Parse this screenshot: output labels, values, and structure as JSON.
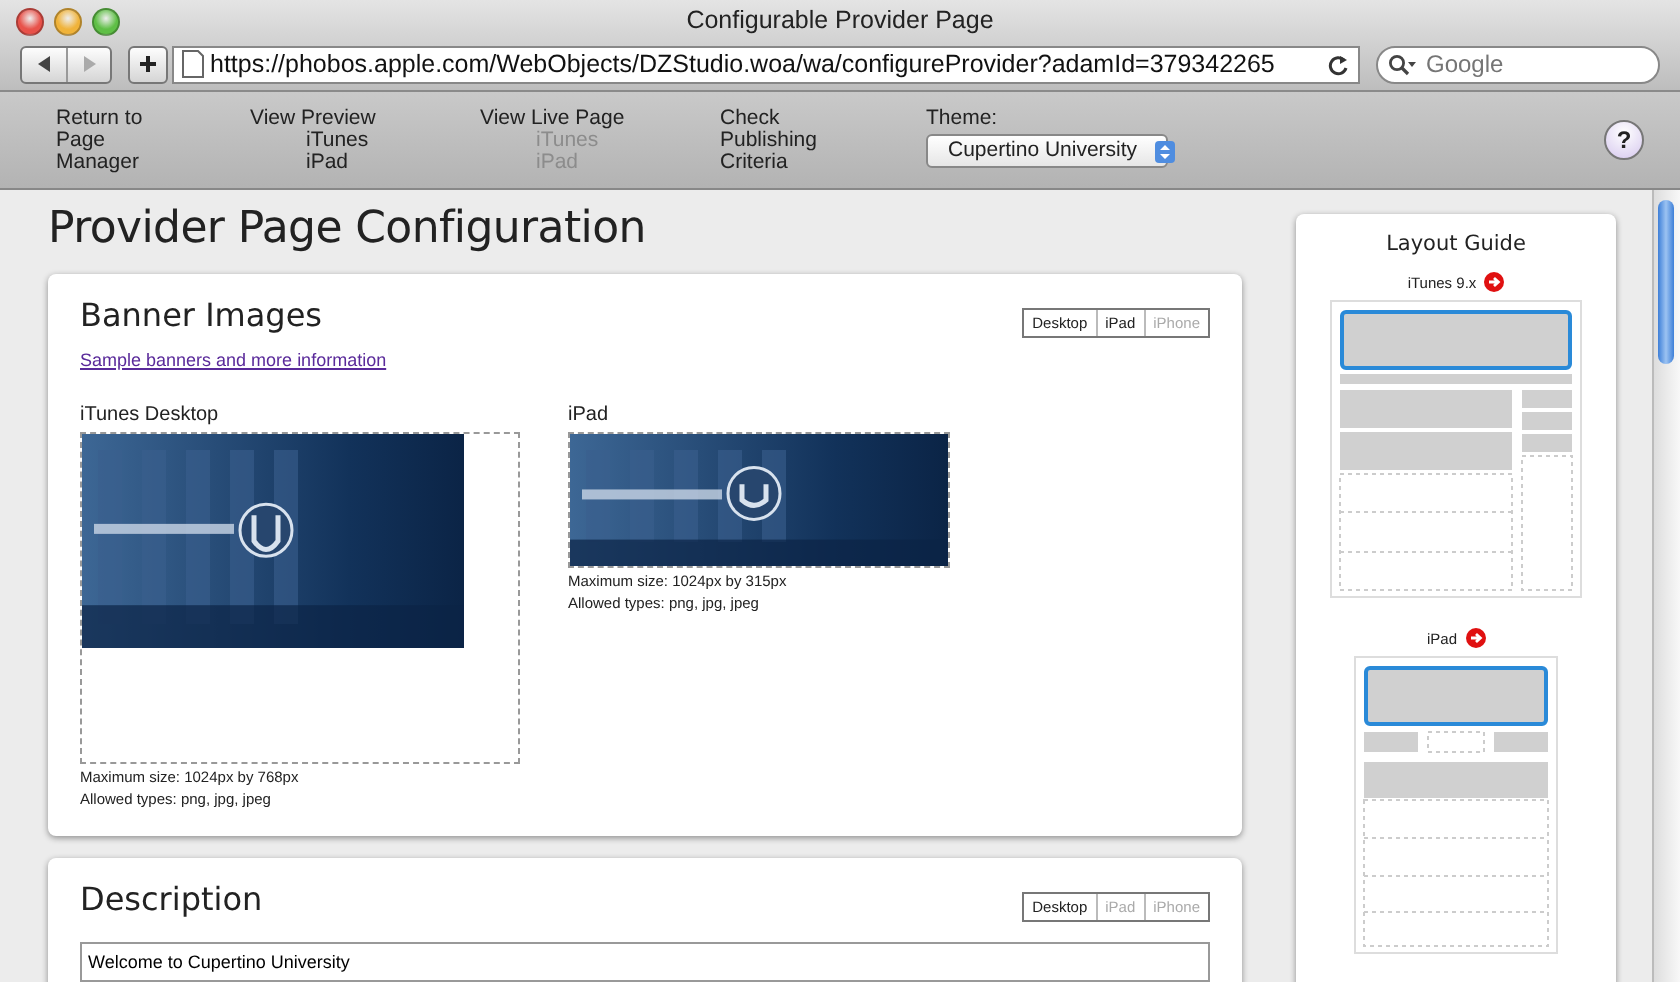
{
  "window": {
    "title": "Configurable Provider Page"
  },
  "browser": {
    "url": "https://phobos.apple.com/WebObjects/DZStudio.woa/wa/configureProvider?adamId=379342265",
    "search": {
      "placeholder": "Google"
    }
  },
  "nav": [
    {
      "label": "Return to Page Manager"
    },
    {
      "label": "View Preview",
      "links": [
        {
          "label": "iTunes",
          "disabled": false
        },
        {
          "label": "iPad",
          "disabled": false
        }
      ]
    },
    {
      "label": "View Live Page",
      "links": [
        {
          "label": "iTunes",
          "disabled": true
        },
        {
          "label": "iPad",
          "disabled": true
        }
      ]
    },
    {
      "label": "Check Publishing Criteria"
    }
  ],
  "theme": {
    "label": "Theme:",
    "value": "Cupertino University"
  },
  "help": {
    "label": "?"
  },
  "page_title": "Provider Page Configuration",
  "banner": {
    "title": "Banner Images",
    "device_tabs": [
      {
        "label": "Desktop",
        "disabled": false
      },
      {
        "label": "iPad",
        "disabled": false
      },
      {
        "label": "iPhone",
        "disabled": true
      }
    ],
    "link": "Sample banners and more information",
    "slots": [
      {
        "kind": "desktop",
        "label": "iTunes Desktop",
        "lines": [
          "Maximum size: 1024px by 768px",
          "Allowed types: png, jpg, jpeg"
        ]
      },
      {
        "kind": "ipad",
        "label": "iPad",
        "lines": [
          "Maximum size: 1024px by 315px",
          "Allowed types: png, jpg, jpeg"
        ]
      }
    ]
  },
  "description": {
    "title": "Description",
    "device_tabs": [
      {
        "label": "Desktop",
        "disabled": false
      },
      {
        "label": "iPad",
        "disabled": true
      },
      {
        "label": "iPhone",
        "disabled": true
      }
    ],
    "value": "Welcome to Cupertino University"
  },
  "layout_guide": {
    "title": "Layout Guide",
    "guides": [
      {
        "kind": "itunes",
        "label": "iTunes 9.x"
      },
      {
        "kind": "ipad",
        "label": "iPad"
      }
    ]
  }
}
